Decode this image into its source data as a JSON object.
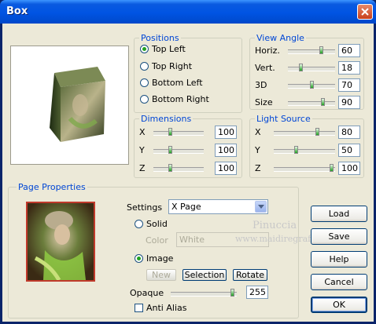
{
  "window": {
    "title": "Box"
  },
  "positions": {
    "legend": "Positions",
    "options": [
      {
        "label": "Top Left",
        "selected": true
      },
      {
        "label": "Top Right",
        "selected": false
      },
      {
        "label": "Bottom Left",
        "selected": false
      },
      {
        "label": "Bottom Right",
        "selected": false
      }
    ]
  },
  "view_angle": {
    "legend": "View Angle",
    "items": [
      {
        "label": "Horiz.",
        "value": "60",
        "fraction": 0.73
      },
      {
        "label": "Vert.",
        "value": "18",
        "fraction": 0.25
      },
      {
        "label": "3D",
        "value": "70",
        "fraction": 0.5
      },
      {
        "label": "Size",
        "value": "90",
        "fraction": 0.76
      }
    ]
  },
  "dimensions": {
    "legend": "Dimensions",
    "items": [
      {
        "label": "X",
        "value": "100",
        "fraction": 0.33
      },
      {
        "label": "Y",
        "value": "100",
        "fraction": 0.33
      },
      {
        "label": "Z",
        "value": "100",
        "fraction": 0.33
      }
    ]
  },
  "light_source": {
    "legend": "Light Source",
    "items": [
      {
        "label": "X",
        "value": "80",
        "fraction": 0.73
      },
      {
        "label": "Y",
        "value": "50",
        "fraction": 0.36
      },
      {
        "label": "Z",
        "value": "100",
        "fraction": 0.97
      }
    ]
  },
  "page_properties": {
    "legend": "Page Properties",
    "settings_label": "Settings",
    "settings_value": "X Page",
    "solid_label": "Solid",
    "color_label": "Color",
    "color_value": "White",
    "image_label": "Image",
    "new_label": "New",
    "selection_label": "Selection",
    "rotate_label": "Rotate",
    "opaque_label": "Opaque",
    "opaque_value": "255",
    "opaque_fraction": 0.96,
    "anti_alias_label": "Anti Alias"
  },
  "buttons": {
    "load": "Load",
    "save": "Save",
    "help": "Help",
    "cancel": "Cancel",
    "ok": "OK"
  },
  "watermark": {
    "line1": "Pinuccia",
    "line2": "www.maidiregrafica.eu"
  },
  "colors": {
    "title_bar": "#0054e3",
    "dialog_bg": "#ece9d8",
    "legend_text": "#0046d5",
    "close_button": "#c8401c"
  }
}
